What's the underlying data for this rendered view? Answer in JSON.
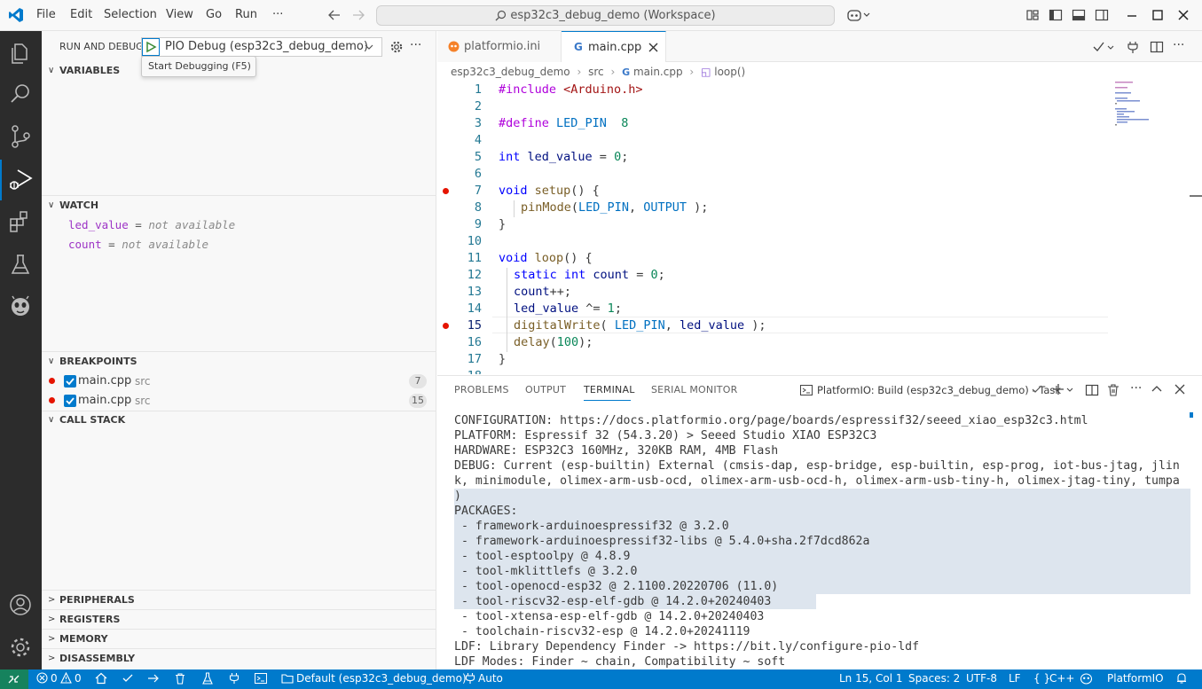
{
  "titlebar": {
    "menu": [
      "File",
      "Edit",
      "Selection",
      "View",
      "Go",
      "Run",
      "···"
    ],
    "command_center": "esp32c3_debug_demo (Workspace)"
  },
  "sidebar": {
    "run_debug_label": "RUN AND DEBUG",
    "config_select": "PIO Debug (esp32c3_debug_demo)",
    "tooltip": "Start Debugging (F5)",
    "variables_header": "VARIABLES",
    "watch_header": "WATCH",
    "watch_items": [
      {
        "name": "led_value",
        "value": "not available"
      },
      {
        "name": "count",
        "value": "not available"
      }
    ],
    "breakpoints_header": "BREAKPOINTS",
    "breakpoints": [
      {
        "file": "main.cpp",
        "folder": "src",
        "line": "7"
      },
      {
        "file": "main.cpp",
        "folder": "src",
        "line": "15"
      }
    ],
    "callstack_header": "CALL STACK",
    "bottom_sections": [
      "PERIPHERALS",
      "REGISTERS",
      "MEMORY",
      "DISASSEMBLY"
    ]
  },
  "editor": {
    "tabs": [
      {
        "label": "platformio.ini",
        "active": false
      },
      {
        "label": "main.cpp",
        "active": true
      }
    ],
    "breadcrumb": [
      "esp32c3_debug_demo",
      "src",
      "main.cpp",
      "loop()"
    ],
    "line_numbers": [
      "1",
      "2",
      "3",
      "4",
      "5",
      "6",
      "7",
      "8",
      "9",
      "10",
      "11",
      "12",
      "13",
      "14",
      "15",
      "16",
      "17"
    ],
    "current_line": 15,
    "breakpoint_lines": [
      7,
      15
    ],
    "code": {
      "l1a": "#include ",
      "l1b": "<Arduino.h>",
      "l3a": "#define ",
      "l3b": "LED_PIN",
      "l3c": "  8",
      "l5a": "int ",
      "l5b": "led_value",
      " l5c": "",
      "l5d": " = ",
      "l5e": "0",
      ";": ";",
      "l7a": "void ",
      "l7b": "setup",
      "l7c": "() {",
      "l8a": "pinMode",
      "l8b": "(",
      "l8c": "LED_PIN",
      ", ": ", ",
      "l8d": "OUTPUT",
      " );": " );",
      "l9": "}",
      "l11a": "void ",
      "l11b": "loop",
      "l11c": "() {",
      "l12a": "static ",
      "l12b": "int ",
      "l12c": "count",
      "l12d": " = ",
      "l12e": "0",
      "l13a": "count",
      "l13b": "++;",
      "l14a": "led_value",
      "l14b": " ^= ",
      "l14c": "1",
      "l15a": "digitalWrite",
      "l15b": "( ",
      "l15c": "LED_PIN",
      "l15d": "led_value",
      "l16a": "delay",
      "l16b": "(",
      "l16c": "100",
      "l16d": ");",
      "l17": "}"
    }
  },
  "panel": {
    "tabs": [
      "PROBLEMS",
      "OUTPUT",
      "TERMINAL",
      "SERIAL MONITOR"
    ],
    "active_tab": "TERMINAL",
    "task_label": "PlatformIO: Build (esp32c3_debug_demo) - Task",
    "terminal_lines": [
      "CONFIGURATION: https://docs.platformio.org/page/boards/espressif32/seeed_xiao_esp32c3.html",
      "PLATFORM: Espressif 32 (54.3.20) > Seeed Studio XIAO ESP32C3",
      "HARDWARE: ESP32C3 160MHz, 320KB RAM, 4MB Flash",
      "DEBUG: Current (esp-builtin) External (cmsis-dap, esp-bridge, esp-builtin, esp-prog, iot-bus-jtag, jlin",
      "k, minimodule, olimex-arm-usb-ocd, olimex-arm-usb-ocd-h, olimex-arm-usb-tiny-h, olimex-jtag-tiny, tumpa",
      ")",
      "PACKAGES:",
      " - framework-arduinoespressif32 @ 3.2.0",
      " - framework-arduinoespressif32-libs @ 5.4.0+sha.2f7dcd862a",
      " - tool-esptoolpy @ 4.8.9",
      " - tool-mklittlefs @ 3.2.0",
      " - tool-openocd-esp32 @ 2.1100.20220706 (11.0)",
      " - tool-riscv32-esp-elf-gdb @ 14.2.0+20240403",
      " - tool-xtensa-esp-elf-gdb @ 14.2.0+20240403",
      " - toolchain-riscv32-esp @ 14.2.0+20241119",
      "LDF: Library Dependency Finder -> https://bit.ly/configure-pio-ldf",
      "LDF Modes: Finder ~ chain, Compatibility ~ soft"
    ]
  },
  "statusbar": {
    "errors": "0",
    "warnings": "0",
    "env": "Default (esp32c3_debug_demo)",
    "port": "Auto",
    "position": "Ln 15, Col 1",
    "spaces": "Spaces: 2",
    "encoding": "UTF-8",
    "eol": "LF",
    "language": "C++",
    "platformio": "PlatformIO"
  },
  "colors": {
    "accent": "#007acc",
    "breakpoint": "#e51400",
    "activity_bar": "#2c2c2c",
    "selection": "#dde5ee"
  }
}
